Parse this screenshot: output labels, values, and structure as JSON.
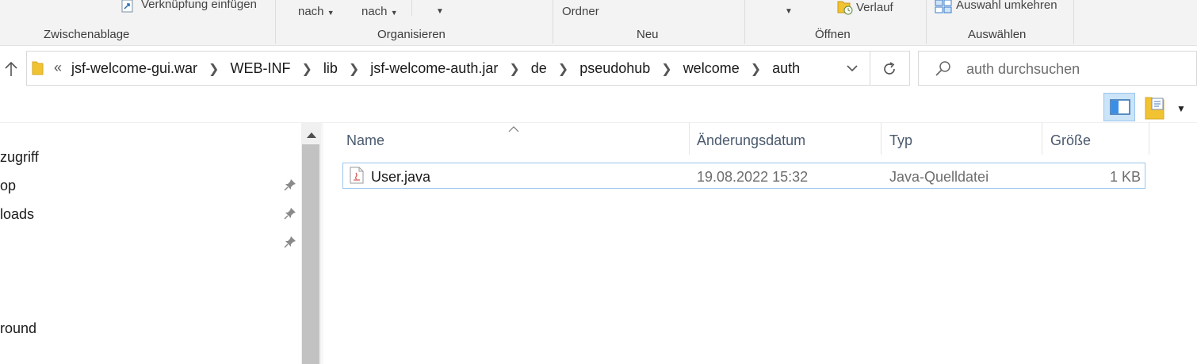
{
  "ribbon": {
    "paste_shortcut_label": "Verknüpfung einfügen",
    "move_to_label": "nach",
    "copy_to_label": "nach",
    "new_folder_label": "Ordner",
    "history_label": "Verlauf",
    "invert_selection_label": "Auswahl umkehren",
    "groups": {
      "clipboard": "Zwischenablage",
      "organize": "Organisieren",
      "new": "Neu",
      "open": "Öffnen",
      "select": "Auswählen"
    }
  },
  "address": {
    "overflow": "«",
    "crumbs": [
      "jsf-welcome-gui.war",
      "WEB-INF",
      "lib",
      "jsf-welcome-auth.jar",
      "de",
      "pseudohub",
      "welcome",
      "auth"
    ]
  },
  "search": {
    "placeholder": "auth durchsuchen"
  },
  "nav": {
    "items": [
      "zugriff",
      "op",
      "loads",
      "round"
    ]
  },
  "columns": {
    "name": "Name",
    "date": "Änderungsdatum",
    "type": "Typ",
    "size": "Größe"
  },
  "files": [
    {
      "name": "User.java",
      "date": "19.08.2022 15:32",
      "type": "Java-Quelldatei",
      "size": "1 KB"
    }
  ],
  "colors": {
    "selection_border": "#99c6ee",
    "accent": "#0078d7",
    "folder": "#f1c232"
  }
}
